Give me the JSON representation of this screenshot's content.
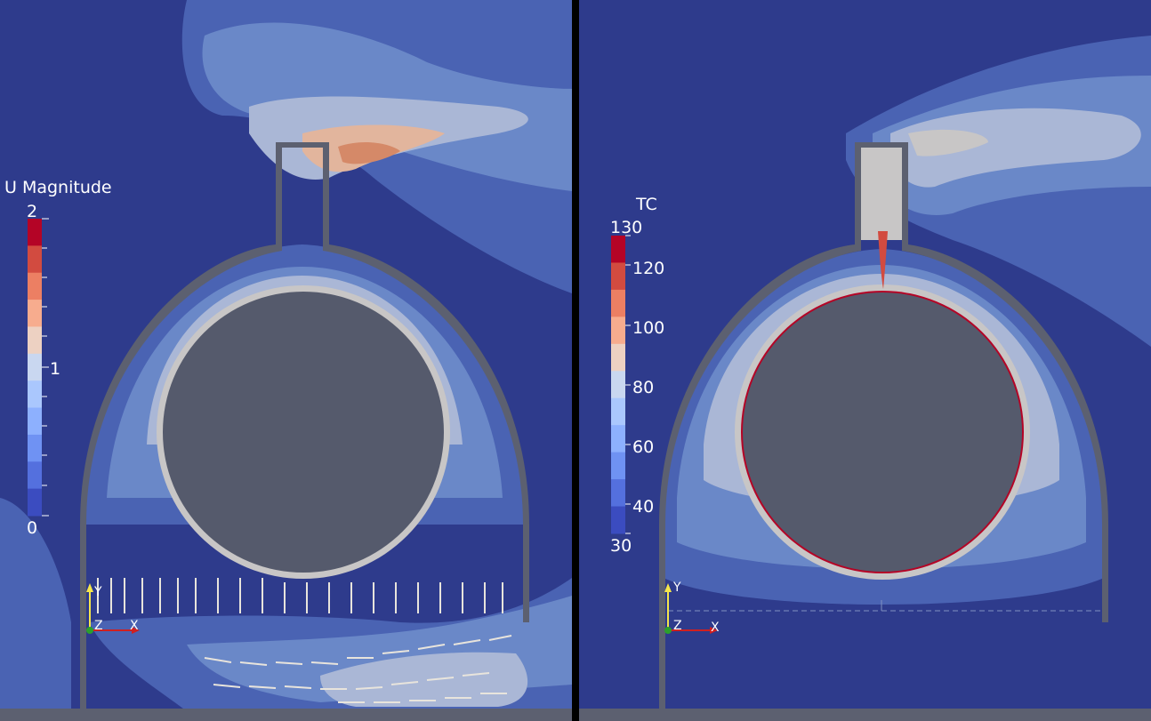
{
  "colors": {
    "background": "#2e3b8c",
    "solid_gray": "#555a6c",
    "wall_gray": "#5c6070",
    "divider": "#000000"
  },
  "left_view": {
    "legend": {
      "title": "U Magnitude",
      "max_label": "2",
      "mid_label": "1",
      "min_label": "0",
      "colors": [
        "#b40426",
        "#d24b40",
        "#ec7f63",
        "#f7ac8e",
        "#edd1c2",
        "#c9d7f0",
        "#aac7fd",
        "#8db0fe",
        "#6f92f3",
        "#5470de",
        "#3b4cc0"
      ]
    },
    "axes": {
      "y": "Y",
      "x": "X",
      "z": "Z"
    }
  },
  "right_view": {
    "legend": {
      "title": "TC",
      "labels": [
        "130",
        "120",
        "100",
        "80",
        "60",
        "40",
        "30"
      ],
      "colors": [
        "#b40426",
        "#d24b40",
        "#ec7f63",
        "#f7ac8e",
        "#edd1c2",
        "#c9d7f0",
        "#aac7fd",
        "#8db0fe",
        "#6f92f3",
        "#5470de",
        "#3b4cc0"
      ]
    },
    "axes": {
      "y": "Y",
      "x": "X",
      "z": "Z"
    }
  }
}
